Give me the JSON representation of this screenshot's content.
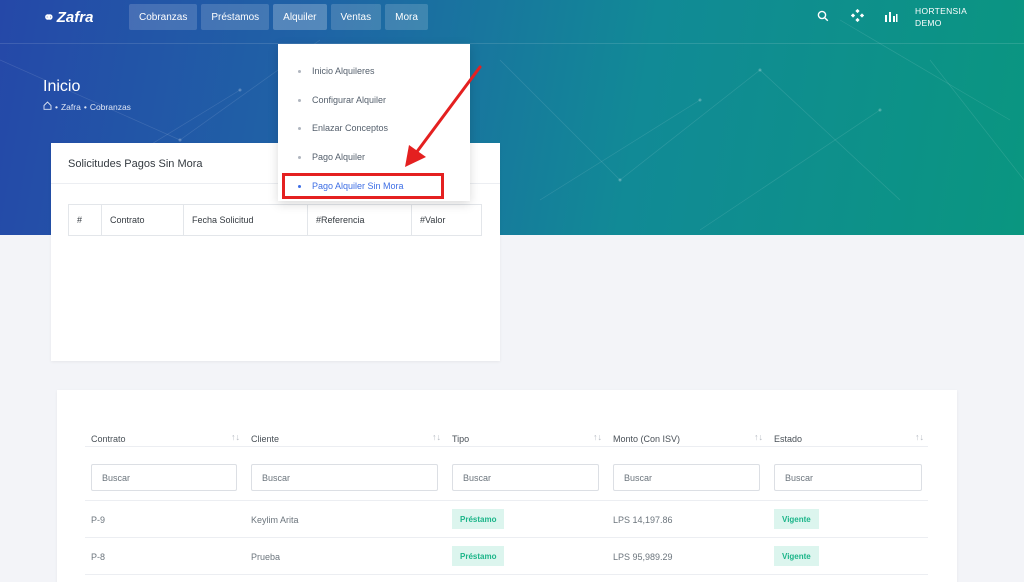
{
  "app": {
    "logo_text": "Zafra",
    "logo_glyph": "⚭"
  },
  "nav": [
    {
      "label": "Cobranzas"
    },
    {
      "label": "Préstamos"
    },
    {
      "label": "Alquiler"
    },
    {
      "label": "Ventas"
    },
    {
      "label": "Mora"
    }
  ],
  "top_icons": [
    "search-icon",
    "apps-icon",
    "chart-bars-icon"
  ],
  "user": {
    "line1": "HORTENSIA",
    "line2": "DEMO"
  },
  "page": {
    "title": "Inicio",
    "breadcrumb": [
      "Zafra",
      "Cobranzas"
    ]
  },
  "dropdown": {
    "items": [
      {
        "label": "Inicio Alquileres"
      },
      {
        "label": "Configurar Alquiler"
      },
      {
        "label": "Enlazar Conceptos"
      },
      {
        "label": "Pago Alquiler"
      },
      {
        "label": "Pago Alquiler Sin Mora"
      }
    ],
    "active_index": 4
  },
  "card1": {
    "title": "Solicitudes Pagos Sin Mora",
    "columns": [
      "#",
      "Contrato",
      "Fecha Solicitud",
      "#Referencia",
      "#Valor"
    ]
  },
  "table": {
    "columns": [
      "Contrato",
      "Cliente",
      "Tipo",
      "Monto (Con ISV)",
      "Estado"
    ],
    "search_placeholder": "Buscar",
    "rows": [
      {
        "contrato": "P-9",
        "cliente": "Keylim Arita",
        "tipo": "Préstamo",
        "monto": "LPS 14,197.86",
        "estado": "Vigente"
      },
      {
        "contrato": "P-8",
        "cliente": "Prueba",
        "tipo": "Préstamo",
        "monto": "LPS 95,989.29",
        "estado": "Vigente"
      }
    ]
  },
  "colors": {
    "accent": "#3d6ee5",
    "badge_bg": "#dcf5ee",
    "badge_text": "#1bb589",
    "annotation": "#e42020"
  }
}
